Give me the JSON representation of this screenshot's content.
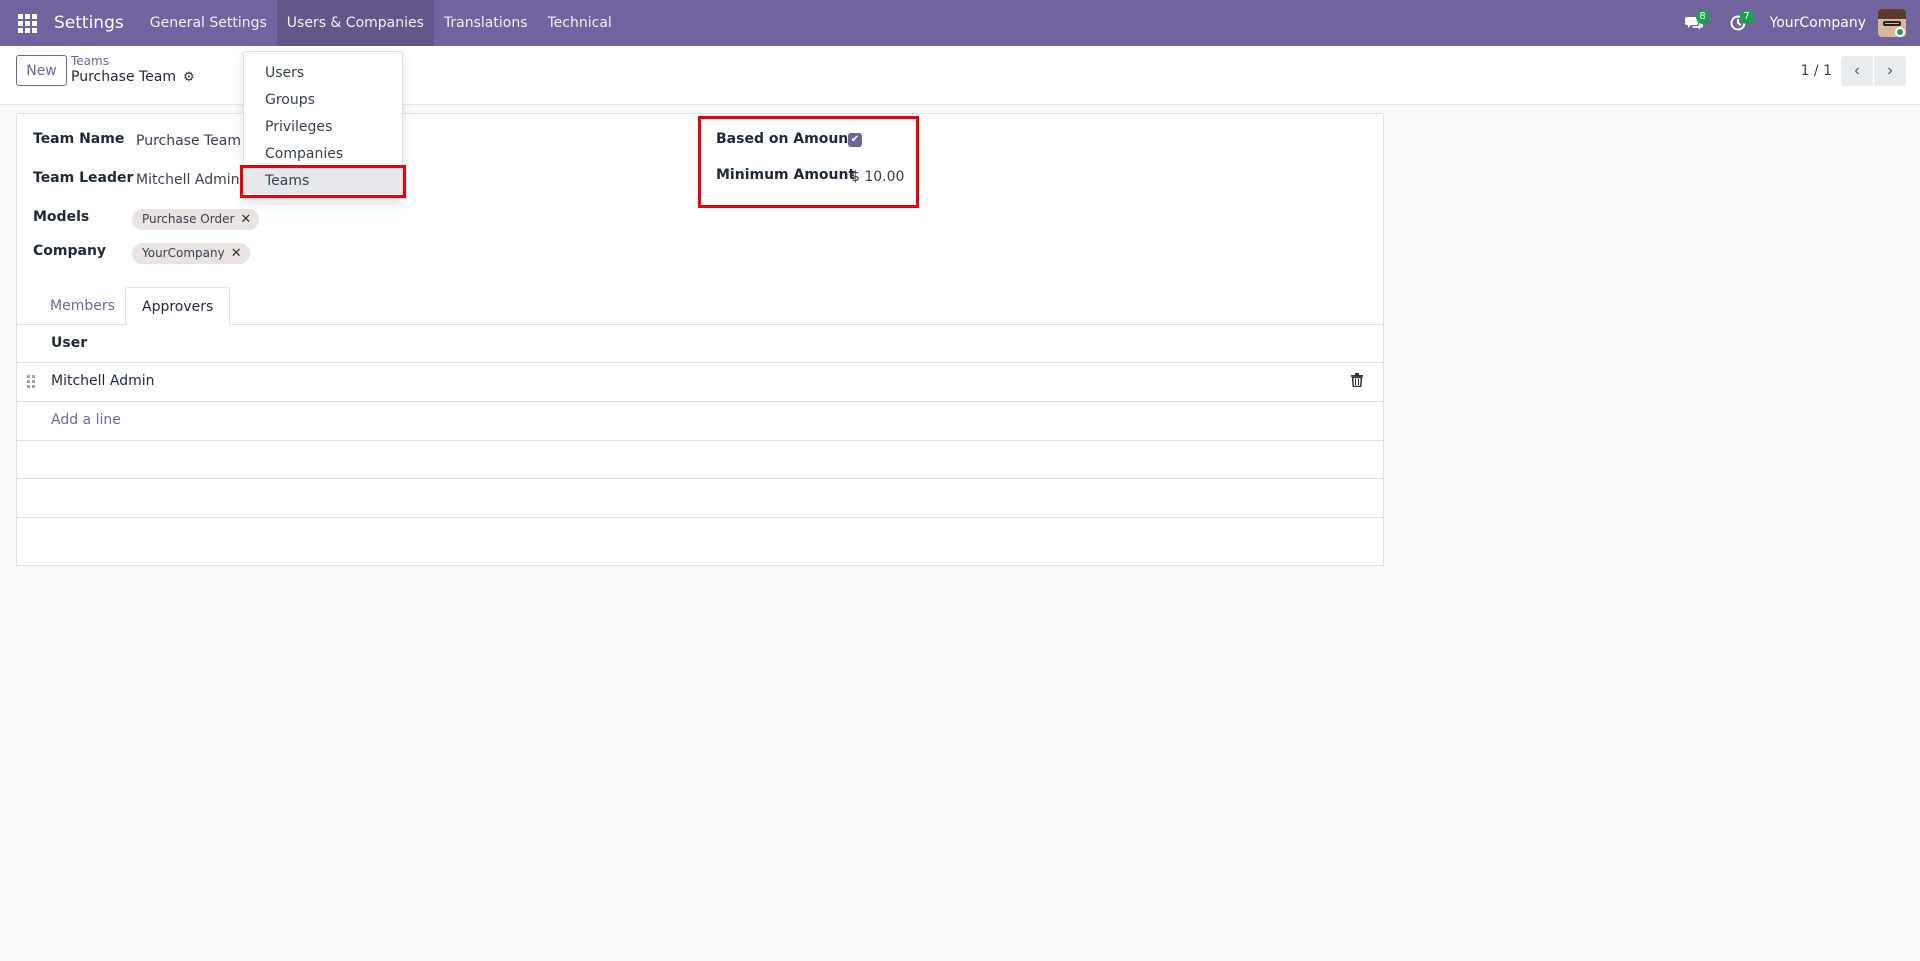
{
  "navbar": {
    "app_title": "Settings",
    "menus": [
      "General Settings",
      "Users & Companies",
      "Translations",
      "Technical"
    ],
    "messages_badge": "8",
    "activities_badge": "7",
    "company": "YourCompany"
  },
  "control_panel": {
    "new_label": "New",
    "breadcrumb_parent": "Teams",
    "breadcrumb_current": "Purchase Team",
    "pager": "1 / 1"
  },
  "dropdown": {
    "items": [
      "Users",
      "Groups",
      "Privileges",
      "Companies",
      "Teams"
    ],
    "selected": "Teams"
  },
  "form": {
    "team_name_label": "Team Name",
    "team_name": "Purchase Team",
    "team_leader_label": "Team Leader",
    "team_leader": "Mitchell Admin",
    "models_label": "Models",
    "models_tag": "Purchase Order",
    "company_label": "Company",
    "company_tag": "YourCompany",
    "based_on_amount_label": "Based on Amount",
    "based_on_amount": true,
    "minimum_amount_label": "Minimum Amount",
    "minimum_amount": "$ 10.00"
  },
  "tabs": {
    "members": "Members",
    "approvers": "Approvers",
    "active": "Approvers"
  },
  "approvers_table": {
    "header_user": "User",
    "rows": [
      "Mitchell Admin"
    ],
    "add_line": "Add a line"
  },
  "colors": {
    "brand": "#71639e",
    "highlight": "#e5040b",
    "badge": "#1ea04a"
  }
}
